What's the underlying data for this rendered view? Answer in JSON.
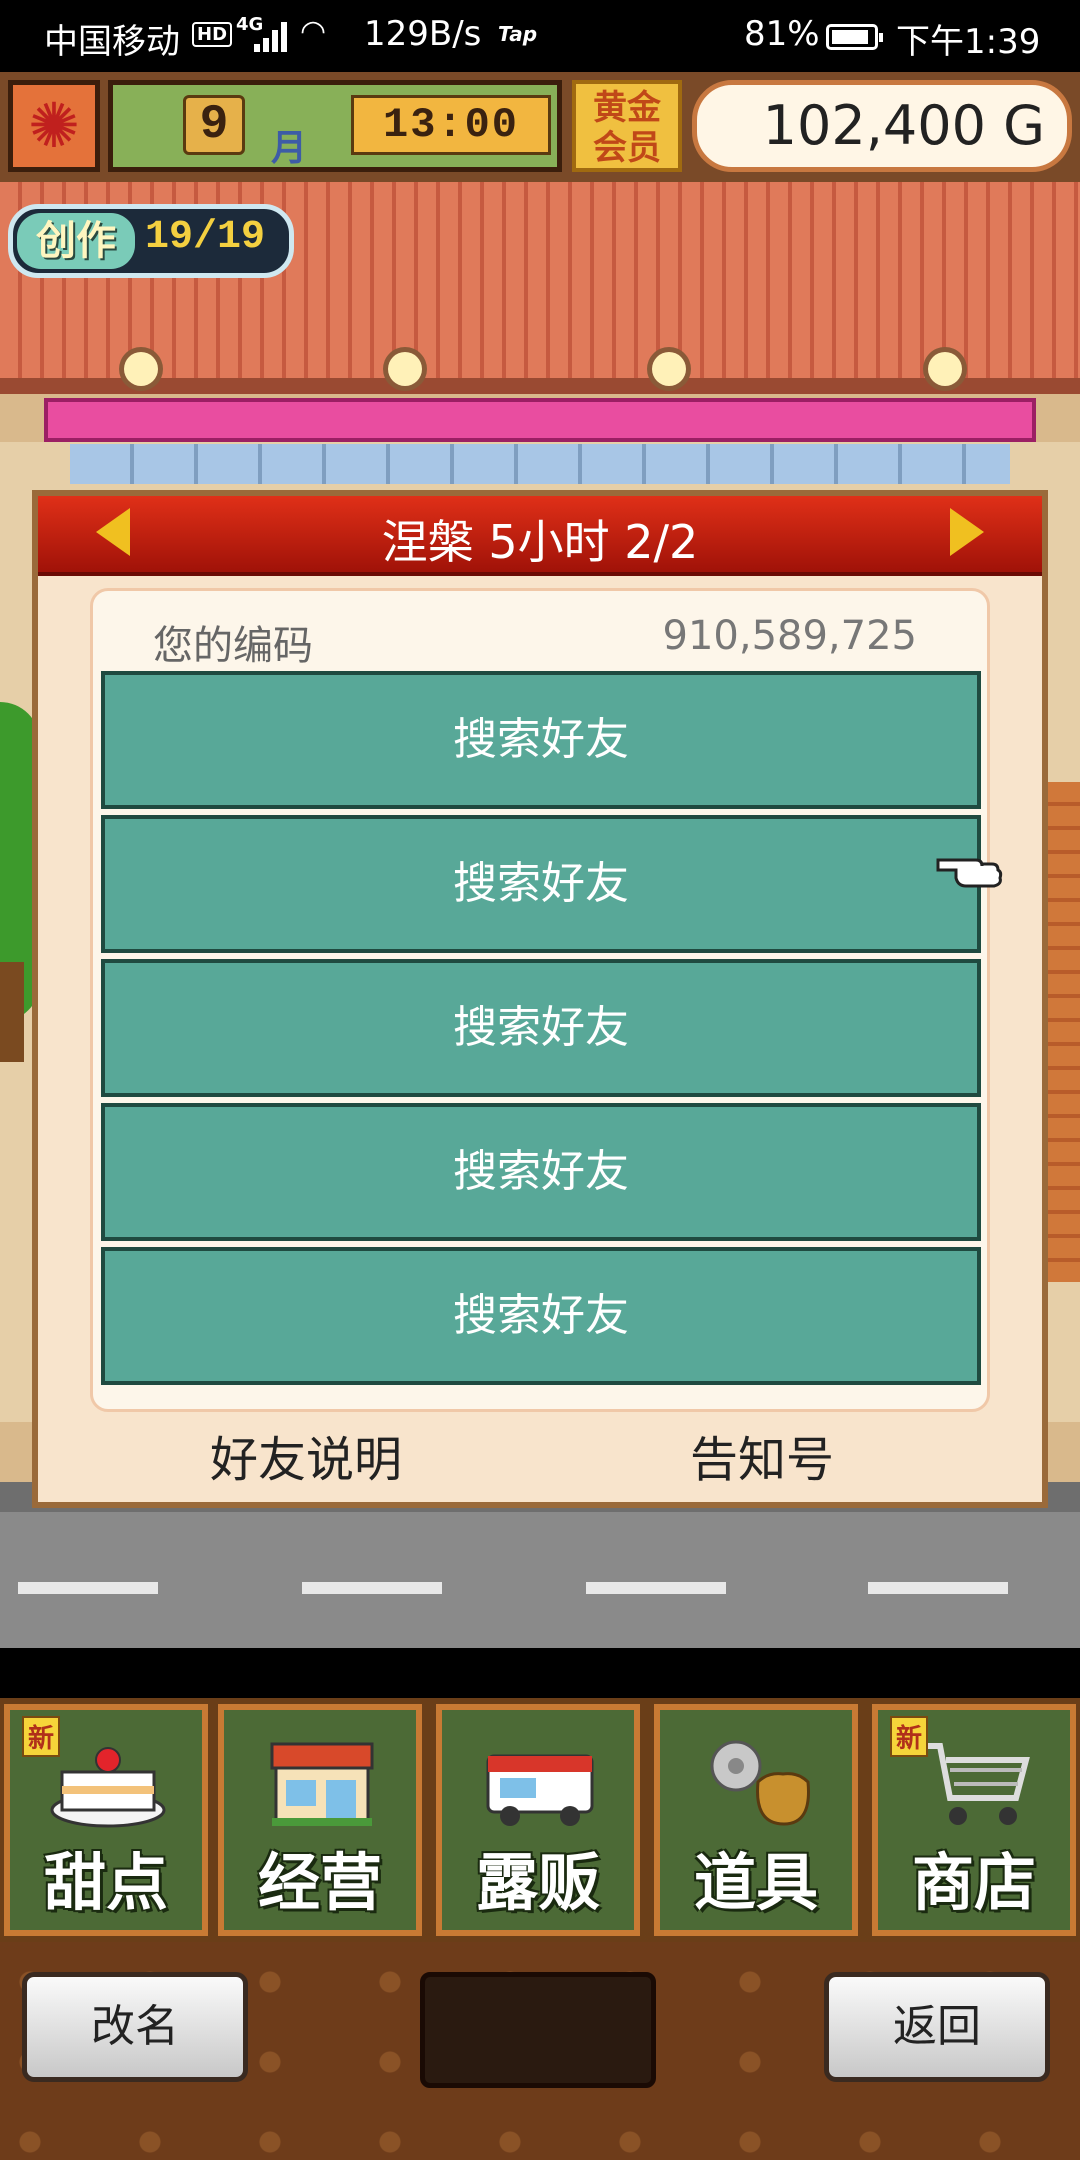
{
  "status_bar": {
    "carrier": "中国移动",
    "hd": "HD",
    "network": "4G",
    "speed": "129B/s",
    "app_badge": "Tap",
    "battery": "81%",
    "time": "下午1:39"
  },
  "hud": {
    "month": "9",
    "month_label": "月",
    "clock": "13:00",
    "member_line1": "黄金",
    "member_line2": "会员",
    "money": "102,400 G",
    "create_label": "创作",
    "create_count": "19/19"
  },
  "dialog": {
    "title": "涅槃  5小时 2/2",
    "code_label": "您的编码",
    "code_value": "910,589,725",
    "friend_slots": [
      "搜索好友",
      "搜索好友",
      "搜索好友",
      "搜索好友",
      "搜索好友"
    ],
    "footer_left": "好友说明",
    "footer_right": "告知号"
  },
  "menu": {
    "items": [
      {
        "label": "甜点",
        "badge": "新",
        "icon": "cake-icon"
      },
      {
        "label": "经营",
        "badge": "",
        "icon": "storefront-icon"
      },
      {
        "label": "露贩",
        "badge": "",
        "icon": "food-truck-icon"
      },
      {
        "label": "道具",
        "badge": "",
        "icon": "items-bag-icon"
      },
      {
        "label": "商店",
        "badge": "新",
        "icon": "shopping-cart-icon"
      }
    ]
  },
  "bottom": {
    "rename": "改名",
    "back": "返回"
  },
  "colors": {
    "dialog_header": "#c01e0e",
    "friend_button": "#58a898",
    "menu_bg": "#4c6a36",
    "awning": "#e94da0"
  }
}
